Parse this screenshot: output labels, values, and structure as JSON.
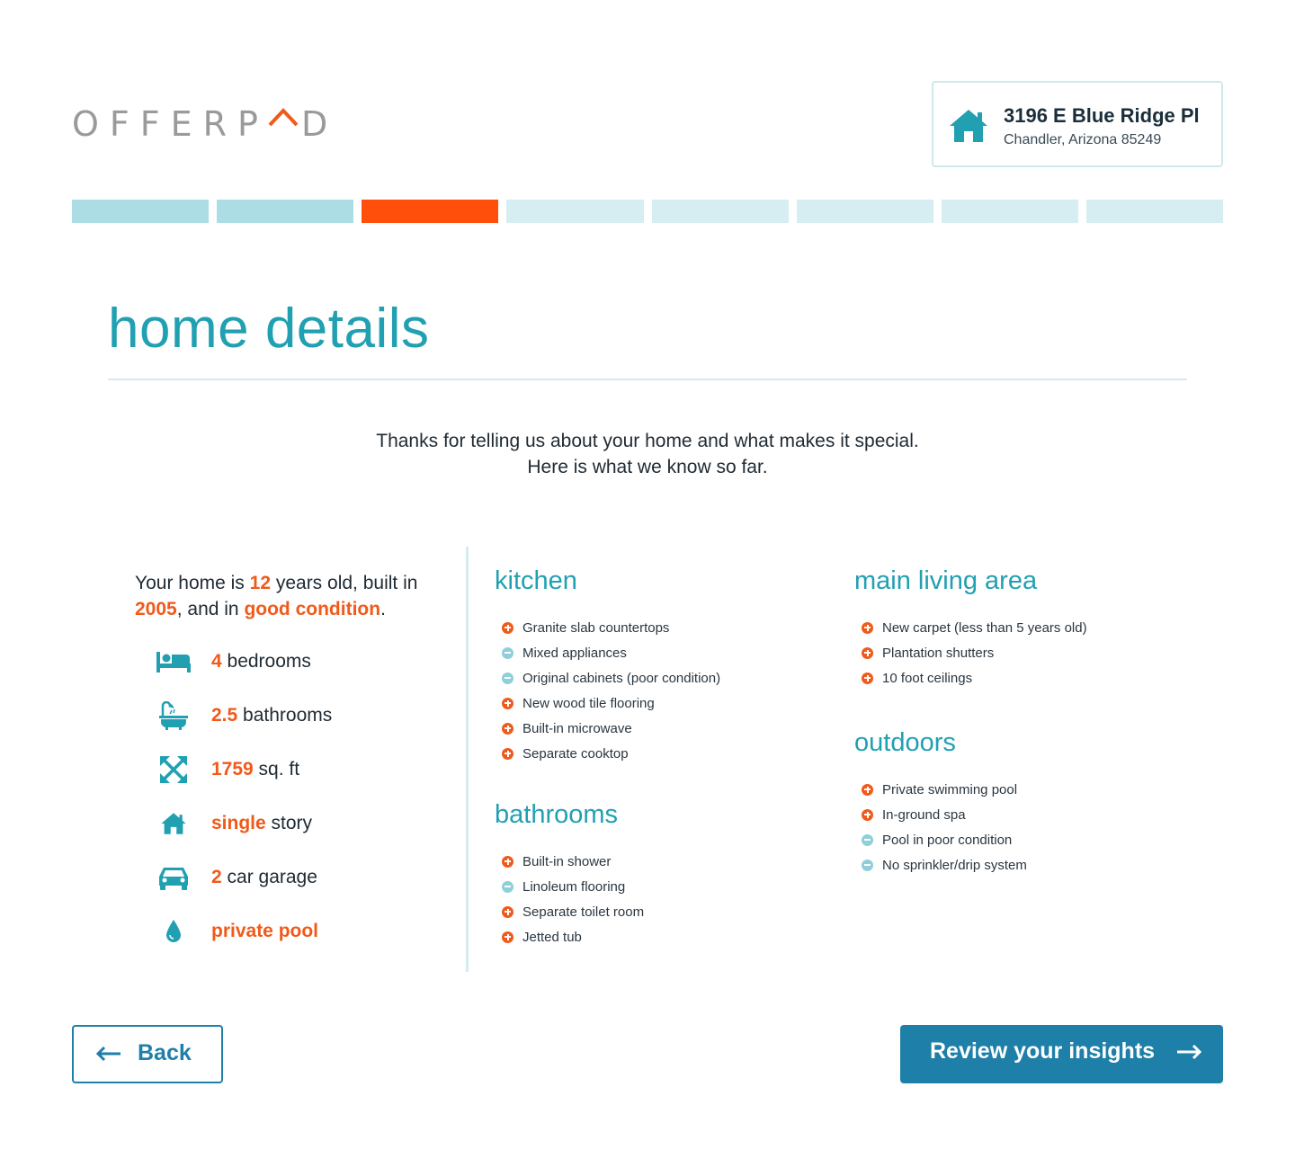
{
  "brand": {
    "logo_text_a": "OFFERP",
    "logo_text_b": "D",
    "accent": "#f05a1a",
    "primary": "#21a0b2",
    "button": "#1e7fa8"
  },
  "address": {
    "line1": "3196 E Blue Ridge Pl",
    "line2": "Chandler, Arizona 85249",
    "icon": "house-icon"
  },
  "progress": {
    "total_steps": 8,
    "current_step": 3,
    "colors": {
      "completed": "#acdde4",
      "current": "#ff4f0a",
      "upcoming": "#d6edf1"
    }
  },
  "page": {
    "title": "home details",
    "intro_line1": "Thanks for telling us about your home and what makes it special.",
    "intro_line2": "Here is what we know so far."
  },
  "summary": {
    "part1": "Your home is ",
    "age": "12",
    "part2": " years old, built in ",
    "year": "2005",
    "part3": ", and in ",
    "condition": "good condition",
    "part4": "."
  },
  "features": [
    {
      "icon": "bed-icon",
      "value": "4",
      "label": " bedrooms"
    },
    {
      "icon": "bathtub-icon",
      "value": "2.5",
      "label": " bathrooms"
    },
    {
      "icon": "expand-arrows-icon",
      "value": "1759",
      "label": " sq. ft"
    },
    {
      "icon": "house-icon",
      "value": "single",
      "label": " story"
    },
    {
      "icon": "car-icon",
      "value": "2",
      "label": " car garage"
    },
    {
      "icon": "water-drop-icon",
      "value": "private pool",
      "label": ""
    }
  ],
  "sections": {
    "kitchen": {
      "title": "kitchen",
      "items": [
        {
          "type": "plus",
          "text": "Granite slab countertops"
        },
        {
          "type": "minus",
          "text": "Mixed appliances"
        },
        {
          "type": "minus",
          "text": "Original cabinets (poor condition)"
        },
        {
          "type": "plus",
          "text": "New wood tile flooring"
        },
        {
          "type": "plus",
          "text": "Built-in microwave"
        },
        {
          "type": "plus",
          "text": "Separate cooktop"
        }
      ]
    },
    "bathrooms": {
      "title": "bathrooms",
      "items": [
        {
          "type": "plus",
          "text": "Built-in shower"
        },
        {
          "type": "minus",
          "text": "Linoleum flooring"
        },
        {
          "type": "plus",
          "text": "Separate toilet room"
        },
        {
          "type": "plus",
          "text": "Jetted tub"
        }
      ]
    },
    "living": {
      "title": "main living area",
      "items": [
        {
          "type": "plus",
          "text": "New carpet (less than 5 years old)"
        },
        {
          "type": "plus",
          "text": "Plantation shutters"
        },
        {
          "type": "plus",
          "text": "10 foot ceilings"
        }
      ]
    },
    "outdoors": {
      "title": "outdoors",
      "items": [
        {
          "type": "plus",
          "text": "Private swimming pool"
        },
        {
          "type": "plus",
          "text": "In-ground spa"
        },
        {
          "type": "minus",
          "text": "Pool in poor condition"
        },
        {
          "type": "minus",
          "text": "No sprinkler/drip system"
        }
      ]
    }
  },
  "buttons": {
    "back": "Back",
    "next": "Review your insights"
  }
}
